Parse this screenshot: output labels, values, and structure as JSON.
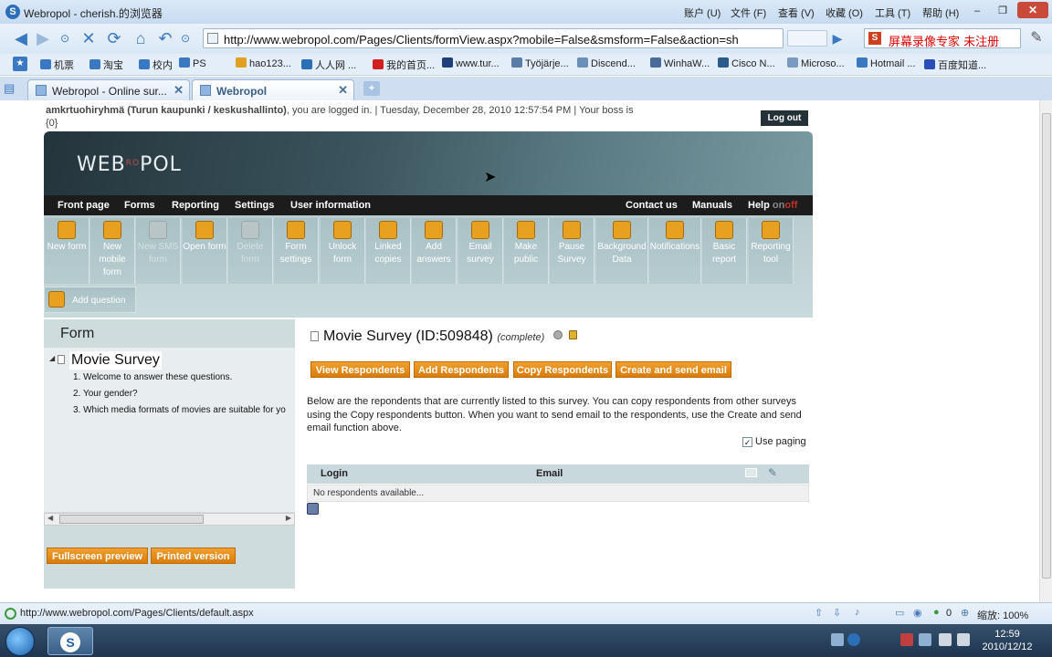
{
  "window": {
    "title": "Webropol - cherish.的浏览器",
    "menu": [
      "账户 (U)",
      "文件 (F)",
      "查看 (V)",
      "收藏 (O)",
      "工具 (T)",
      "帮助 (H)"
    ],
    "controls": {
      "minimize": "–",
      "restore": "❐",
      "close": "✕"
    }
  },
  "nav": {
    "url": "http://www.webropol.com/Pages/Clients/formView.aspx?mobile=False&smsform=False&action=sh",
    "search_value": "屏幕录像专家  未注册"
  },
  "bookmarks": [
    {
      "label": "机票",
      "color": "#3a78c2"
    },
    {
      "label": "淘宝",
      "color": "#3a78c2"
    },
    {
      "label": "校内",
      "color": "#3a78c2"
    },
    {
      "label": "PS",
      "color": "#3a78c2"
    },
    {
      "label": "hao123...",
      "color": "#e0a020"
    },
    {
      "label": "人人网 ...",
      "color": "#2a6fb8"
    },
    {
      "label": "我的首页...",
      "color": "#d02020"
    },
    {
      "label": "www.tur...",
      "color": "#1d3f7a"
    },
    {
      "label": "Työjärje...",
      "color": "#5a7da8"
    },
    {
      "label": "Discend...",
      "color": "#6a8fb8"
    },
    {
      "label": "WinhaW...",
      "color": "#4a6a9a"
    },
    {
      "label": "Cisco N...",
      "color": "#2a5a8a"
    },
    {
      "label": "Microso...",
      "color": "#7a9ac0"
    },
    {
      "label": "Hotmail ...",
      "color": "#3a78c2"
    },
    {
      "label": "百度知道...",
      "color": "#2a4fb8"
    }
  ],
  "tabs": [
    {
      "label": "Webropol - Online sur..."
    },
    {
      "label": "Webropol"
    }
  ],
  "login_info": {
    "org": "amkrtuohiryhmä (Turun kaupunki / keskushallinto)",
    "text": ", you are logged in. | Tuesday, December 28, 2010 12:57:54 PM | Your boss is {0}"
  },
  "logout_label": "Log out",
  "logo_text": "WEBROPOL",
  "main_nav": {
    "left": [
      "Front page",
      "Forms",
      "Reporting",
      "Settings",
      "User information"
    ],
    "right": [
      "Contact us",
      "Manuals",
      "Help"
    ],
    "help_suffix_on": "on",
    "help_suffix_off": "off"
  },
  "tools": [
    {
      "label": "New form",
      "enabled": true
    },
    {
      "label": "New mobile form",
      "enabled": true
    },
    {
      "label": "New SMS form",
      "enabled": false
    },
    {
      "label": "Open form",
      "enabled": true
    },
    {
      "label": "Delete form",
      "enabled": false
    },
    {
      "label": "Form settings",
      "enabled": true
    },
    {
      "label": "Unlock form",
      "enabled": true
    },
    {
      "label": "Linked copies",
      "enabled": true
    },
    {
      "label": "Add answers",
      "enabled": true
    },
    {
      "label": "Email survey",
      "enabled": true
    },
    {
      "label": "Make public",
      "enabled": true
    },
    {
      "label": "Pause Survey",
      "enabled": true
    },
    {
      "label": "Background Data",
      "enabled": true
    },
    {
      "label": "Notifications",
      "enabled": true
    },
    {
      "label": "Basic report",
      "enabled": true
    },
    {
      "label": "Reporting tool",
      "enabled": true
    }
  ],
  "add_question_label": "Add question",
  "form_panel": {
    "header": "Form",
    "root": "Movie Survey",
    "questions": [
      "1. Welcome to answer these questions.",
      "2. Your gender?",
      "3. Which media formats of movies are suitable for yo"
    ],
    "fullscreen_label": "Fullscreen preview",
    "printed_label": "Printed version"
  },
  "survey": {
    "title": "Movie Survey (ID:509848)",
    "status": "(complete)",
    "buttons": [
      "View Respondents",
      "Add Respondents",
      "Copy Respondents",
      "Create and send email"
    ],
    "description": "Below are the repondents that are currently listed to this survey. You can copy respondents from other surveys using the Copy respondents button. When you want to send email to the respondents, use the Create and send email function above.",
    "use_paging_label": "Use paging",
    "use_paging_checked": true,
    "columns": [
      "Login",
      "Email"
    ],
    "empty_text": "No respondents available..."
  },
  "status_bar": {
    "url": "http://www.webropol.com/Pages/Clients/default.aspx",
    "zero": "0",
    "zoom": "缩放: 100%"
  },
  "clock": {
    "time": "12:59",
    "date": "2010/12/12"
  }
}
